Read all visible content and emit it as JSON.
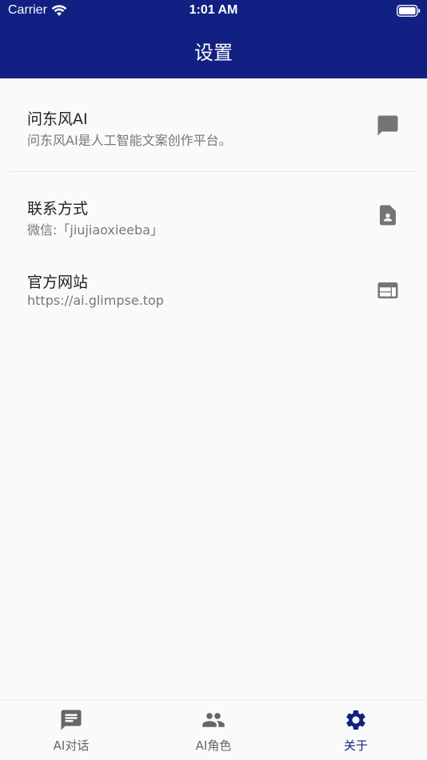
{
  "status_bar": {
    "carrier": "Carrier",
    "time": "1:01 AM"
  },
  "header": {
    "title": "设置",
    "background": "#112082"
  },
  "items": [
    {
      "title": "问东风AI",
      "subtitle": "问东风AI是人工智能文案创作平台。",
      "icon": "chat-bubble-icon"
    },
    {
      "title": "联系方式",
      "subtitle": "微信:「jiujiaoxieeba」",
      "icon": "contact-card-icon"
    },
    {
      "title": "官方网站",
      "subtitle": "https://ai.glimpse.top",
      "icon": "web-window-icon"
    }
  ],
  "tabs": [
    {
      "label": "AI对话",
      "icon": "chat-icon",
      "active": false
    },
    {
      "label": "AI角色",
      "icon": "people-icon",
      "active": false
    },
    {
      "label": "关于",
      "icon": "gear-icon",
      "active": true
    }
  ],
  "colors": {
    "accent": "#112082",
    "inactive": "#666666",
    "icon_gray": "#757575"
  }
}
